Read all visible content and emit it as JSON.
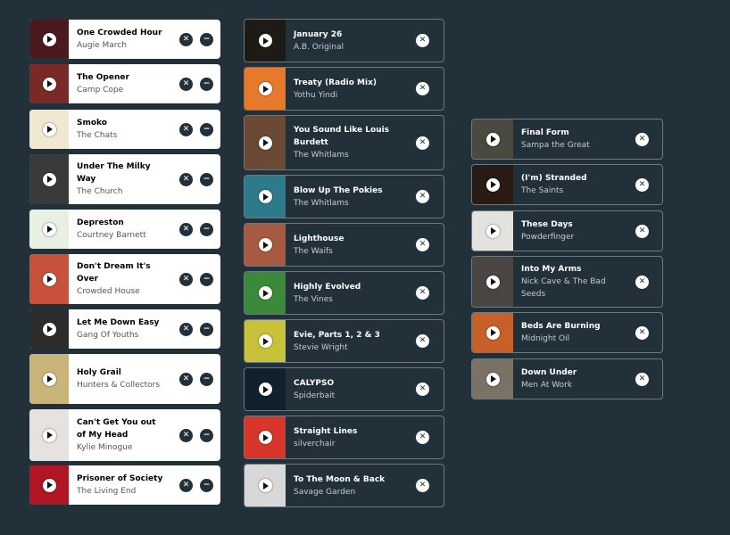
{
  "icons": {
    "play": "play-icon",
    "remove": "close-icon",
    "minus": "minus-icon"
  },
  "colors": {
    "background": "#22303a",
    "card_light": "#ffffff",
    "card_border": "#6d7982"
  },
  "columns": [
    {
      "tracks": [
        {
          "title": "One Crowded Hour",
          "artist": "Augie March",
          "art": "#4a1a1e"
        },
        {
          "title": "The Opener",
          "artist": "Camp Cope",
          "art": "#7a2a26"
        },
        {
          "title": "Smoko",
          "artist": "The Chats",
          "art": "#f0e8d0"
        },
        {
          "title": "Under The Milky Way",
          "artist": "The Church",
          "art": "#3a3a3a"
        },
        {
          "title": "Depreston",
          "artist": "Courtney Barnett",
          "art": "#e8f0e4"
        },
        {
          "title": "Don't Dream It's Over",
          "artist": "Crowded House",
          "art": "#c7513a"
        },
        {
          "title": "Let Me Down Easy",
          "artist": "Gang Of Youths",
          "art": "#2c2c2c"
        },
        {
          "title": "Holy Grail",
          "artist": "Hunters & Collectors",
          "art": "#c9b57a"
        },
        {
          "title": "Can't Get You out of My Head",
          "artist": "Kylie Minogue",
          "art": "#e6e2e0"
        },
        {
          "title": "Prisoner of Society",
          "artist": "The Living End",
          "art": "#b01624"
        }
      ]
    },
    {
      "tracks": [
        {
          "title": "January 26",
          "artist": "A.B. Original",
          "art": "#1e1a16"
        },
        {
          "title": "Treaty (Radio Mix)",
          "artist": "Yothu Yindi",
          "art": "#e9792a"
        },
        {
          "title": "You Sound Like Louis Burdett",
          "artist": "The Whitlams",
          "art": "#6a4a34"
        },
        {
          "title": "Blow Up The Pokies",
          "artist": "The Whitlams",
          "art": "#2c7a8a"
        },
        {
          "title": "Lighthouse",
          "artist": "The Waifs",
          "art": "#a85a40"
        },
        {
          "title": "Highly Evolved",
          "artist": "The Vines",
          "art": "#3a8a3a"
        },
        {
          "title": "Evie, Parts 1, 2 & 3",
          "artist": "Stevie Wright",
          "art": "#c8c23a"
        },
        {
          "title": "CALYPSO",
          "artist": "Spiderbait",
          "art": "#12202e"
        },
        {
          "title": "Straight Lines",
          "artist": "silverchair",
          "art": "#d8362a"
        },
        {
          "title": "To The Moon & Back",
          "artist": "Savage Garden",
          "art": "#d8d8d8"
        }
      ]
    },
    {
      "tracks": [
        {
          "title": "Final Form",
          "artist": "Sampa the Great",
          "art": "#4a4a40"
        },
        {
          "title": "(I'm) Stranded",
          "artist": "The Saints",
          "art": "#2a1a14"
        },
        {
          "title": "These Days",
          "artist": "Powderfinger",
          "art": "#e4e2de"
        },
        {
          "title": "Into My Arms",
          "artist": "Nick Cave & The Bad Seeds",
          "art": "#4a4644"
        },
        {
          "title": "Beds Are Burning",
          "artist": "Midnight Oil",
          "art": "#c8602a"
        },
        {
          "title": "Down Under",
          "artist": "Men At Work",
          "art": "#7a7264"
        }
      ]
    }
  ]
}
